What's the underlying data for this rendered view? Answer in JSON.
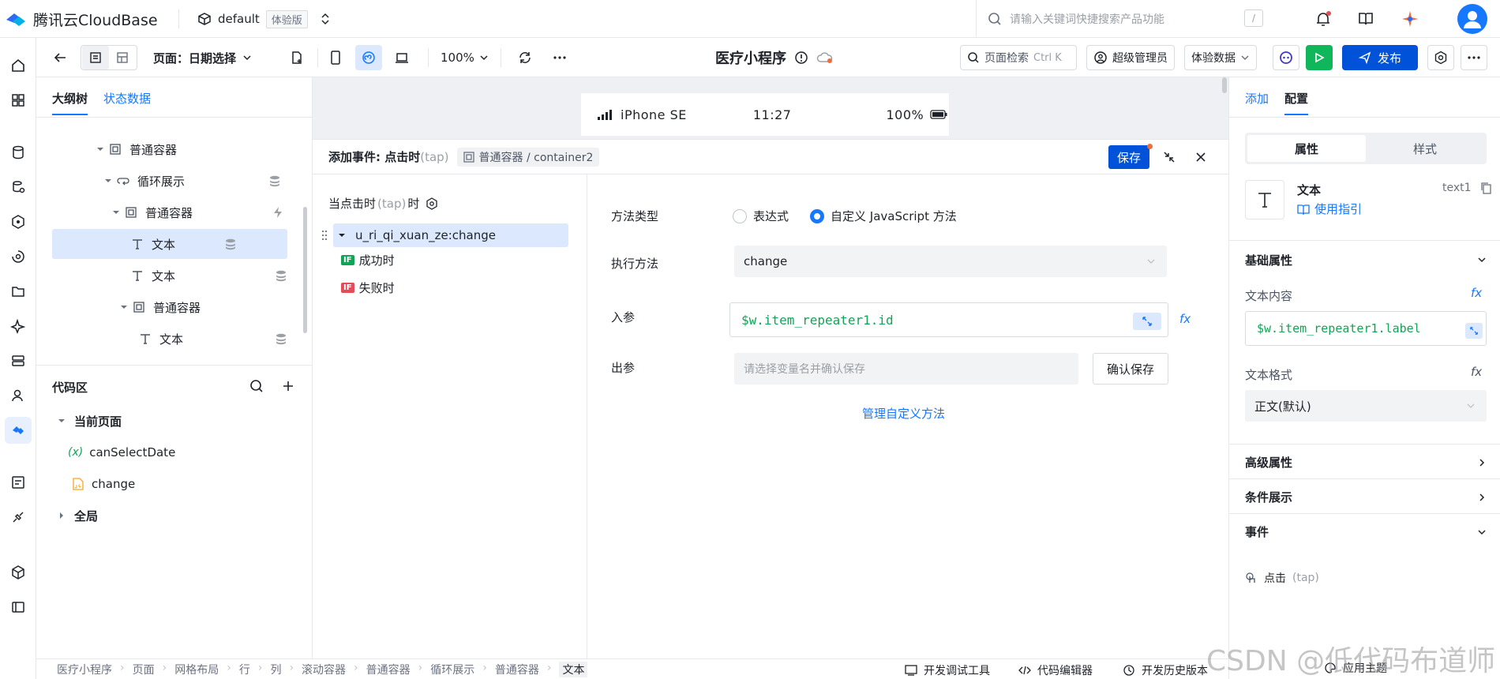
{
  "app": {
    "brand": "腾讯云CloudBase",
    "env_name": "default",
    "env_badge": "体验版",
    "search_placeholder": "请输入关键词快捷搜索产品功能",
    "search_key": "/"
  },
  "toolbar": {
    "page_label": "页面：日期选择",
    "zoom": "100%",
    "app_name": "医疗小程序",
    "page_search": "页面检索",
    "page_search_key": "Ctrl K",
    "role": "超级管理员",
    "data_mode": "体验数据",
    "publish": "发布"
  },
  "left": {
    "tabs": [
      "大纲树",
      "状态数据"
    ],
    "tree": [
      {
        "label": "普通容器",
        "icon": "container-icon"
      },
      {
        "label": "循环展示",
        "icon": "loop-icon"
      },
      {
        "label": "普通容器",
        "icon": "container-icon"
      },
      {
        "label": "文本",
        "icon": "text-icon"
      },
      {
        "label": "文本",
        "icon": "text-icon"
      },
      {
        "label": "普通容器",
        "icon": "container-icon"
      },
      {
        "label": "文本",
        "icon": "text-icon"
      }
    ],
    "code_title": "代码区",
    "code": {
      "current_page": "当前页面",
      "var1": "canSelectDate",
      "var1_prefix": "(x)",
      "fn1": "change",
      "global": "全局"
    }
  },
  "device": {
    "name": "iPhone SE",
    "time": "11:27",
    "battery": "100%"
  },
  "event": {
    "title": "添加事件: 点击时",
    "title_suffix": "(tap)",
    "breadcrumb": "普通容器 / container2",
    "save": "保存",
    "trigger_label": "当点击时",
    "trigger_suffix": "(tap)",
    "trigger_tail": "时",
    "action": "u_ri_qi_xuan_ze:change",
    "success": "成功时",
    "fail": "失败时",
    "if_label": "IF",
    "method_type_label": "方法类型",
    "opt_expr": "表达式",
    "opt_js": "自定义 JavaScript 方法",
    "exec_label": "执行方法",
    "exec_value": "change",
    "in_label": "入参",
    "in_value": "$w.item_repeater1.id",
    "out_label": "出参",
    "out_placeholder": "请选择变量名并确认保存",
    "confirm": "确认保存",
    "manage": "管理自定义方法"
  },
  "right": {
    "tabs": [
      "添加",
      "配置"
    ],
    "seg": [
      "属性",
      "样式"
    ],
    "comp_name": "文本",
    "comp_id": "text1",
    "guide": "使用指引",
    "basic": "基础属性",
    "content_label": "文本内容",
    "content_value": "$w.item_repeater1.label",
    "format_label": "文本格式",
    "format_value": "正文(默认)",
    "advanced": "高级属性",
    "condition": "条件展示",
    "events": "事件",
    "tap": "点击",
    "tap_suffix": "(tap)",
    "fx": "fx"
  },
  "status": {
    "crumbs": [
      "医疗小程序",
      "页面",
      "网格布局",
      "行",
      "列",
      "滚动容器",
      "普通容器",
      "循环展示",
      "普通容器",
      "文本"
    ],
    "devtools": "开发调试工具",
    "code_editor": "代码编辑器",
    "history": "开发历史版本",
    "theme": "应用主题"
  },
  "watermark": "CSDN @低代码布道师",
  "colors": {
    "primary": "#0052d9",
    "accent": "#1677ff",
    "green": "#13a356",
    "run": "#10b65a",
    "selected": "#dbe8fd",
    "if_green": "#13a356",
    "if_red": "#e34d59"
  }
}
